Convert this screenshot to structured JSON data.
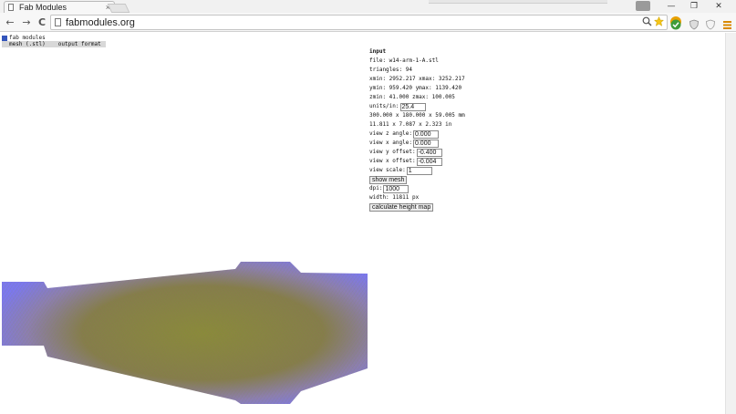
{
  "browser": {
    "tab_title": "Fab Modules",
    "tab_close": "×",
    "url": "fabmodules.org",
    "back": "←",
    "forward": "→",
    "reload": "C",
    "window_controls": {
      "minimize": "—",
      "restore": "❐",
      "close": "✕"
    }
  },
  "app": {
    "title": "fab modules",
    "menu": [
      "mesh (.stl)",
      "output format"
    ]
  },
  "input": {
    "heading": "input",
    "file": "file: w14-arm-1-A.stl",
    "triangles": "triangles: 94",
    "xrange": "xmin: 2952.217 xmax: 3252.217",
    "yrange": "ymin: 959.420 ymax: 1139.420",
    "zrange": "zmin: 41.000 zmax: 100.005",
    "units_label": "units/in:",
    "units_value": "25.4",
    "size_mm": "300.000 x 180.000 x 59.005 mm",
    "size_in": "11.811 x 7.087 x 2.323 in",
    "view_z_angle_label": "view z angle:",
    "view_z_angle_value": "0.000",
    "view_x_angle_label": "view x angle:",
    "view_x_angle_value": "0.000",
    "view_y_offset_label": "view y offset:",
    "view_y_offset_value": "-0.400",
    "view_x_offset_label": "view x offset:",
    "view_x_offset_value": "-0.004",
    "view_scale_label": "view scale:",
    "view_scale_value": "1",
    "show_mesh": "show mesh",
    "dpi_label": "dpi:",
    "dpi_value": "1000",
    "width": "width: 11811 px",
    "calc_button": "calculate height map"
  },
  "colors": {
    "mesh_edge": "#7b78f0",
    "mesh_center": "#8a8a3a",
    "accent_blue": "#3355bb"
  }
}
